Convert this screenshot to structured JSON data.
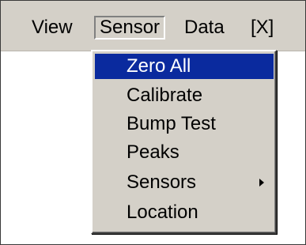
{
  "menubar": {
    "items": [
      {
        "label": "View"
      },
      {
        "label": "Sensor"
      },
      {
        "label": "Data"
      },
      {
        "label": "[X]"
      }
    ]
  },
  "dropdown": {
    "items": [
      {
        "label": "Zero All",
        "selected": true
      },
      {
        "label": "Calibrate"
      },
      {
        "label": "Bump Test"
      },
      {
        "label": "Peaks"
      },
      {
        "label": "Sensors",
        "submenu": true
      },
      {
        "label": "Location"
      }
    ]
  },
  "colors": {
    "menu_face": "#d4d0c8",
    "highlight": "#0a2a9e",
    "highlight_text": "#ffffff"
  },
  "icons": {
    "submenu": "chevron-right-icon"
  }
}
